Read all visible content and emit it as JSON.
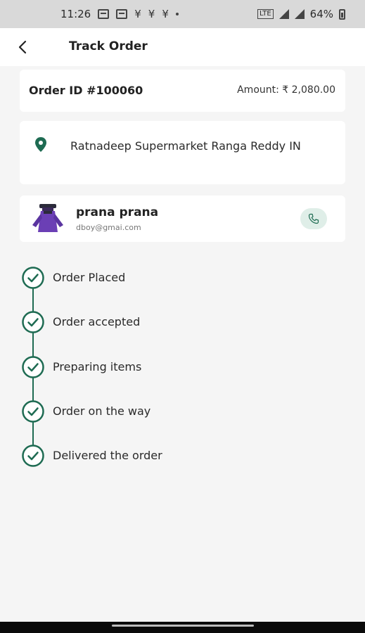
{
  "status_bar": {
    "time": "11:26",
    "battery": "64%",
    "network": "LTE",
    "icons": [
      "sim-box-icon",
      "sim-box-icon",
      "tally-icon",
      "tally-icon",
      "tally-icon",
      "dot-icon",
      "lte-icon",
      "signal-icon",
      "signal-icon",
      "battery-icon"
    ]
  },
  "header": {
    "title": "Track Order",
    "back_icon": "chevron-left-icon"
  },
  "order": {
    "id_label": "Order ID #100060",
    "amount_label": "Amount: ₹ 2,080.00"
  },
  "address": {
    "icon": "location-pin-icon",
    "text": "Ratnadeep Supermarket Ranga Reddy IN"
  },
  "driver": {
    "name": "prana prana",
    "email": "dboy@gmai.com",
    "call_icon": "phone-icon"
  },
  "timeline": {
    "steps": [
      {
        "label": "Order Placed"
      },
      {
        "label": "Order accepted"
      },
      {
        "label": "Preparing items"
      },
      {
        "label": "Order on the way"
      },
      {
        "label": "Delivered the order"
      }
    ]
  },
  "colors": {
    "accent": "#1e6b52",
    "call_bg": "#dfeee8",
    "page_bg": "#f5f5f5",
    "card_bg": "#ffffff"
  }
}
